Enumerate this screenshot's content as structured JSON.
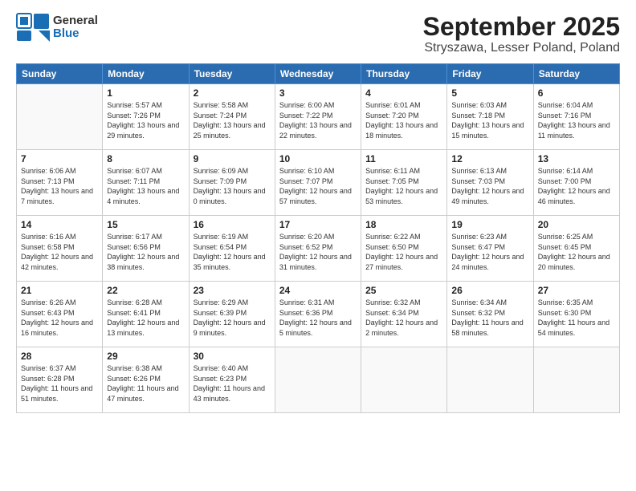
{
  "logo": {
    "general": "General",
    "blue": "Blue"
  },
  "header": {
    "month": "September 2025",
    "location": "Stryszawa, Lesser Poland, Poland"
  },
  "weekdays": [
    "Sunday",
    "Monday",
    "Tuesday",
    "Wednesday",
    "Thursday",
    "Friday",
    "Saturday"
  ],
  "weeks": [
    [
      {
        "num": "",
        "sunrise": "",
        "sunset": "",
        "daylight": ""
      },
      {
        "num": "1",
        "sunrise": "Sunrise: 5:57 AM",
        "sunset": "Sunset: 7:26 PM",
        "daylight": "Daylight: 13 hours and 29 minutes."
      },
      {
        "num": "2",
        "sunrise": "Sunrise: 5:58 AM",
        "sunset": "Sunset: 7:24 PM",
        "daylight": "Daylight: 13 hours and 25 minutes."
      },
      {
        "num": "3",
        "sunrise": "Sunrise: 6:00 AM",
        "sunset": "Sunset: 7:22 PM",
        "daylight": "Daylight: 13 hours and 22 minutes."
      },
      {
        "num": "4",
        "sunrise": "Sunrise: 6:01 AM",
        "sunset": "Sunset: 7:20 PM",
        "daylight": "Daylight: 13 hours and 18 minutes."
      },
      {
        "num": "5",
        "sunrise": "Sunrise: 6:03 AM",
        "sunset": "Sunset: 7:18 PM",
        "daylight": "Daylight: 13 hours and 15 minutes."
      },
      {
        "num": "6",
        "sunrise": "Sunrise: 6:04 AM",
        "sunset": "Sunset: 7:16 PM",
        "daylight": "Daylight: 13 hours and 11 minutes."
      }
    ],
    [
      {
        "num": "7",
        "sunrise": "Sunrise: 6:06 AM",
        "sunset": "Sunset: 7:13 PM",
        "daylight": "Daylight: 13 hours and 7 minutes."
      },
      {
        "num": "8",
        "sunrise": "Sunrise: 6:07 AM",
        "sunset": "Sunset: 7:11 PM",
        "daylight": "Daylight: 13 hours and 4 minutes."
      },
      {
        "num": "9",
        "sunrise": "Sunrise: 6:09 AM",
        "sunset": "Sunset: 7:09 PM",
        "daylight": "Daylight: 13 hours and 0 minutes."
      },
      {
        "num": "10",
        "sunrise": "Sunrise: 6:10 AM",
        "sunset": "Sunset: 7:07 PM",
        "daylight": "Daylight: 12 hours and 57 minutes."
      },
      {
        "num": "11",
        "sunrise": "Sunrise: 6:11 AM",
        "sunset": "Sunset: 7:05 PM",
        "daylight": "Daylight: 12 hours and 53 minutes."
      },
      {
        "num": "12",
        "sunrise": "Sunrise: 6:13 AM",
        "sunset": "Sunset: 7:03 PM",
        "daylight": "Daylight: 12 hours and 49 minutes."
      },
      {
        "num": "13",
        "sunrise": "Sunrise: 6:14 AM",
        "sunset": "Sunset: 7:00 PM",
        "daylight": "Daylight: 12 hours and 46 minutes."
      }
    ],
    [
      {
        "num": "14",
        "sunrise": "Sunrise: 6:16 AM",
        "sunset": "Sunset: 6:58 PM",
        "daylight": "Daylight: 12 hours and 42 minutes."
      },
      {
        "num": "15",
        "sunrise": "Sunrise: 6:17 AM",
        "sunset": "Sunset: 6:56 PM",
        "daylight": "Daylight: 12 hours and 38 minutes."
      },
      {
        "num": "16",
        "sunrise": "Sunrise: 6:19 AM",
        "sunset": "Sunset: 6:54 PM",
        "daylight": "Daylight: 12 hours and 35 minutes."
      },
      {
        "num": "17",
        "sunrise": "Sunrise: 6:20 AM",
        "sunset": "Sunset: 6:52 PM",
        "daylight": "Daylight: 12 hours and 31 minutes."
      },
      {
        "num": "18",
        "sunrise": "Sunrise: 6:22 AM",
        "sunset": "Sunset: 6:50 PM",
        "daylight": "Daylight: 12 hours and 27 minutes."
      },
      {
        "num": "19",
        "sunrise": "Sunrise: 6:23 AM",
        "sunset": "Sunset: 6:47 PM",
        "daylight": "Daylight: 12 hours and 24 minutes."
      },
      {
        "num": "20",
        "sunrise": "Sunrise: 6:25 AM",
        "sunset": "Sunset: 6:45 PM",
        "daylight": "Daylight: 12 hours and 20 minutes."
      }
    ],
    [
      {
        "num": "21",
        "sunrise": "Sunrise: 6:26 AM",
        "sunset": "Sunset: 6:43 PM",
        "daylight": "Daylight: 12 hours and 16 minutes."
      },
      {
        "num": "22",
        "sunrise": "Sunrise: 6:28 AM",
        "sunset": "Sunset: 6:41 PM",
        "daylight": "Daylight: 12 hours and 13 minutes."
      },
      {
        "num": "23",
        "sunrise": "Sunrise: 6:29 AM",
        "sunset": "Sunset: 6:39 PM",
        "daylight": "Daylight: 12 hours and 9 minutes."
      },
      {
        "num": "24",
        "sunrise": "Sunrise: 6:31 AM",
        "sunset": "Sunset: 6:36 PM",
        "daylight": "Daylight: 12 hours and 5 minutes."
      },
      {
        "num": "25",
        "sunrise": "Sunrise: 6:32 AM",
        "sunset": "Sunset: 6:34 PM",
        "daylight": "Daylight: 12 hours and 2 minutes."
      },
      {
        "num": "26",
        "sunrise": "Sunrise: 6:34 AM",
        "sunset": "Sunset: 6:32 PM",
        "daylight": "Daylight: 11 hours and 58 minutes."
      },
      {
        "num": "27",
        "sunrise": "Sunrise: 6:35 AM",
        "sunset": "Sunset: 6:30 PM",
        "daylight": "Daylight: 11 hours and 54 minutes."
      }
    ],
    [
      {
        "num": "28",
        "sunrise": "Sunrise: 6:37 AM",
        "sunset": "Sunset: 6:28 PM",
        "daylight": "Daylight: 11 hours and 51 minutes."
      },
      {
        "num": "29",
        "sunrise": "Sunrise: 6:38 AM",
        "sunset": "Sunset: 6:26 PM",
        "daylight": "Daylight: 11 hours and 47 minutes."
      },
      {
        "num": "30",
        "sunrise": "Sunrise: 6:40 AM",
        "sunset": "Sunset: 6:23 PM",
        "daylight": "Daylight: 11 hours and 43 minutes."
      },
      {
        "num": "",
        "sunrise": "",
        "sunset": "",
        "daylight": ""
      },
      {
        "num": "",
        "sunrise": "",
        "sunset": "",
        "daylight": ""
      },
      {
        "num": "",
        "sunrise": "",
        "sunset": "",
        "daylight": ""
      },
      {
        "num": "",
        "sunrise": "",
        "sunset": "",
        "daylight": ""
      }
    ]
  ]
}
